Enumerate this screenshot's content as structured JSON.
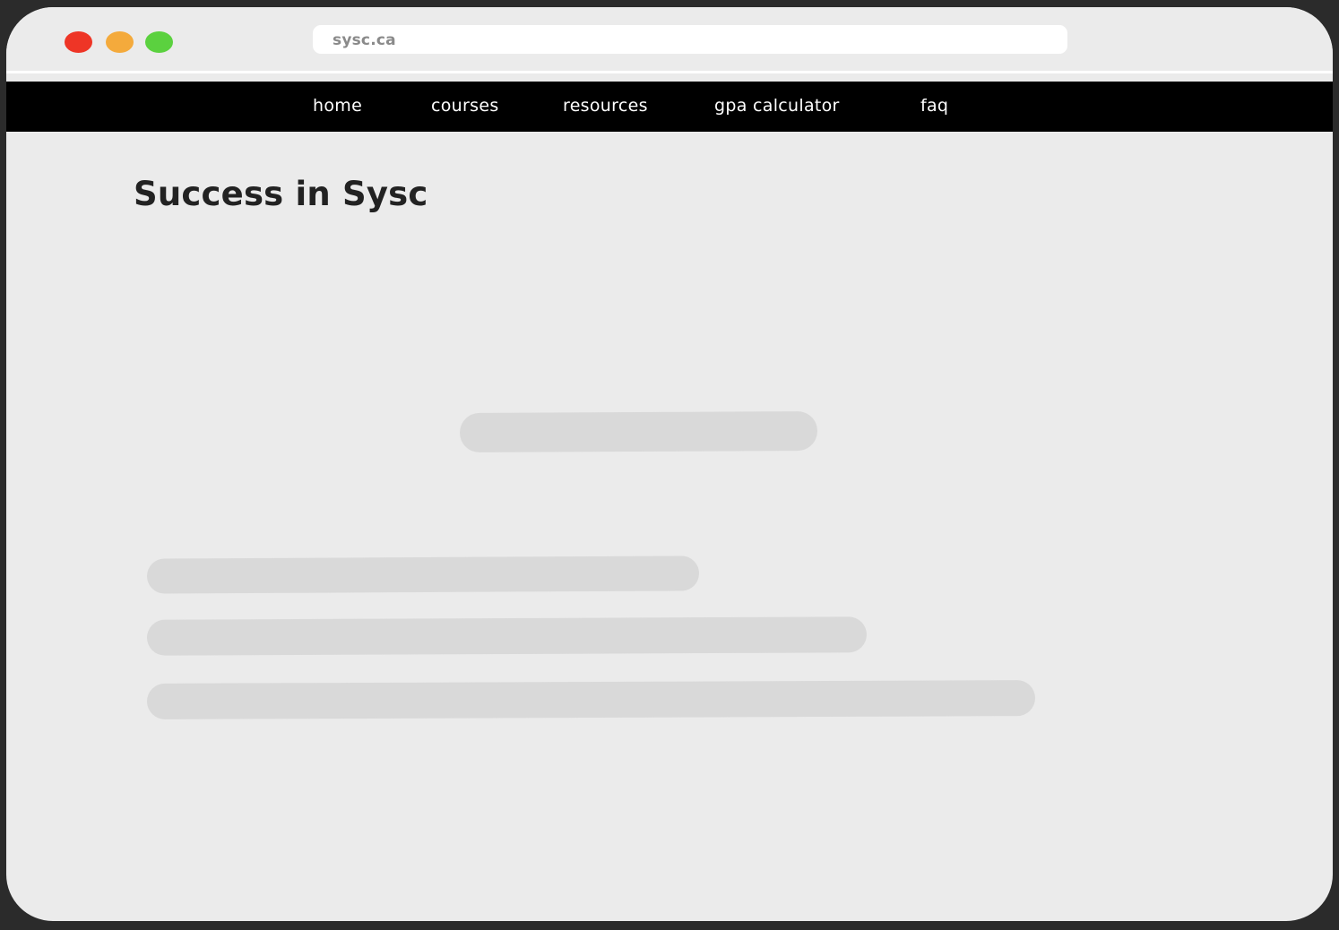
{
  "browser": {
    "url": "sysc.ca",
    "controls": {
      "close_color": "#ee3526",
      "minimize_color": "#f4aa3c",
      "maximize_color": "#5bd13f"
    }
  },
  "nav": {
    "items": [
      {
        "label": "home"
      },
      {
        "label": "courses"
      },
      {
        "label": "resources"
      },
      {
        "label": "gpa calculator"
      },
      {
        "label": "faq"
      }
    ]
  },
  "main": {
    "title": "Success in Sysc"
  },
  "colors": {
    "background": "#ebebeb",
    "navbar": "#000000",
    "placeholder": "#d9d9d9",
    "title_text": "#222222"
  }
}
